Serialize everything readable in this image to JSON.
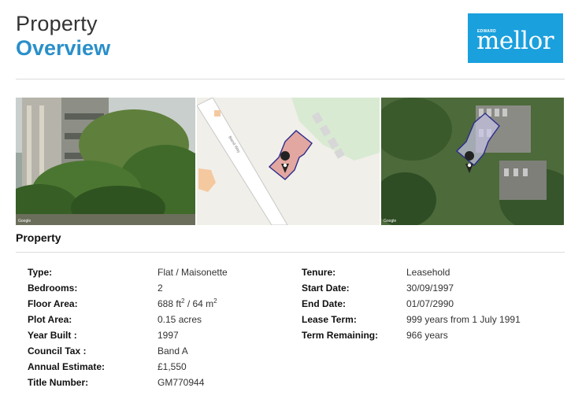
{
  "header": {
    "title_line1": "Property",
    "title_line2": "Overview"
  },
  "logo": {
    "small_text": "EDWARD",
    "main_text": "mellor",
    "color": "#1aa0dd"
  },
  "images": [
    {
      "name": "street-view-photo",
      "credit": "Google"
    },
    {
      "name": "map-view",
      "road_label": "Bland Way"
    },
    {
      "name": "satellite-view",
      "credit": "Google"
    }
  ],
  "section": {
    "title": "Property"
  },
  "details_left": [
    {
      "label": "Type:",
      "value": "Flat / Maisonette"
    },
    {
      "label": "Bedrooms:",
      "value": "2"
    },
    {
      "label": "Floor Area:",
      "value": "688 ft",
      "sup1": "2",
      "value_mid": " / 64 m",
      "sup2": "2"
    },
    {
      "label": "Plot Area:",
      "value": "0.15 acres"
    },
    {
      "label": "Year Built :",
      "value": "1997"
    },
    {
      "label": "Council Tax :",
      "value": "Band A"
    },
    {
      "label": "Annual Estimate:",
      "value": "£1,550"
    },
    {
      "label": "Title Number:",
      "value": "GM770944"
    }
  ],
  "details_right": [
    {
      "label": "Tenure:",
      "value": "Leasehold"
    },
    {
      "label": "Start Date:",
      "value": "30/09/1997"
    },
    {
      "label": "End Date:",
      "value": "01/07/2990"
    },
    {
      "label": "Lease Term:",
      "value": "999 years from 1 July 1991"
    },
    {
      "label": "Term Remaining:",
      "value": "966 years"
    }
  ],
  "colors": {
    "accent": "#2a8fc9",
    "divider": "#dcdcdc"
  }
}
